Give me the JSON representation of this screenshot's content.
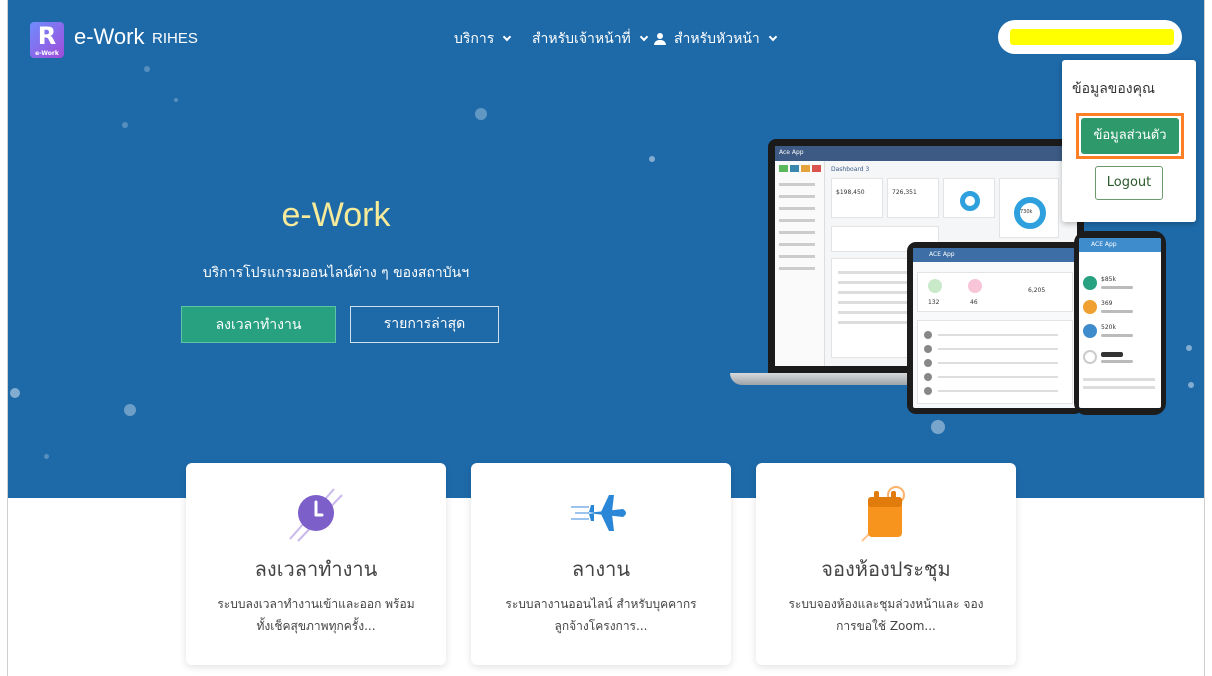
{
  "brand": {
    "logo_letter": "R",
    "logo_small": "e-Work",
    "name": "e-Work",
    "sub": "RIHES"
  },
  "nav": {
    "items": [
      "บริการ",
      "สำหรับเจ้าหน้าที่",
      "สำหรับหัวหน้า"
    ]
  },
  "user_menu": {
    "title": "ข้อมูลของคุณ",
    "profile_button": "ข้อมูลส่วนตัว",
    "logout_button": "Logout"
  },
  "hero": {
    "title": "e-Work",
    "subtitle": "บริการโปรแกรมออนไลน์ต่าง ๆ ของสถาบันฯ",
    "primary_button": "ลงเวลาทำงาน",
    "secondary_button": "รายการล่าสุด"
  },
  "cards": [
    {
      "title": "ลงเวลาทำงาน",
      "line1": "ระบบลงเวลาทำงานเข้าและออก พร้อม",
      "line2": "ทั้งเช็คสุขภาพทุกครั้ง..."
    },
    {
      "title": "ลางาน",
      "line1": "ระบบลางานออนไลน์ สำหรับบุคคากร",
      "line2": "ลูกจ้างโครงการ..."
    },
    {
      "title": "จองห้องประชุม",
      "line1": "ระบบจองห้องและชุมล่วงหน้าและ จอง",
      "line2": "การขอใช้ Zoom..."
    }
  ],
  "colors": {
    "hero_bg": "#1e6aa9",
    "accent_green": "#27a17f",
    "highlight_orange": "#ff7f27",
    "hero_title": "#f7eb9a"
  },
  "mockup": {
    "laptop_app_title": "Ace App",
    "dashboard_title": "Dashboard 3",
    "stat_values": [
      "$198,450",
      "726,351",
      "730k"
    ],
    "tablet_app_title": "ACE App",
    "tablet_values": [
      "132",
      "46",
      "6,205"
    ],
    "phone_app_title": "ACE App",
    "phone_values": [
      "$85k",
      "369",
      "520k"
    ]
  }
}
